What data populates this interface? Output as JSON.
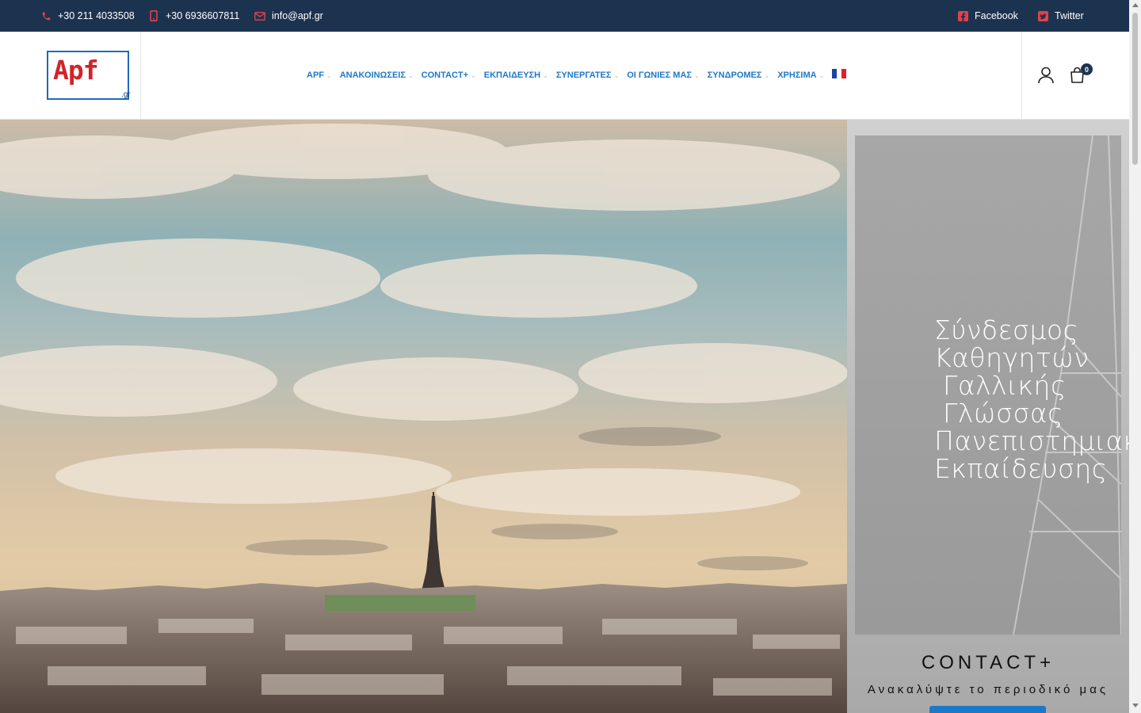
{
  "topbar": {
    "phone": "+30 211 4033508",
    "mobile": "+30 6936607811",
    "email": "info@apf.gr",
    "facebook": "Facebook",
    "twitter": "Twitter",
    "icons": {
      "phone": "phone-icon",
      "mobile": "mobile-icon",
      "email": "envelope-icon",
      "facebook": "facebook-icon",
      "twitter": "twitter-icon"
    },
    "colors": {
      "background": "#1c3350",
      "icon_accent": "#e4404a"
    }
  },
  "logo": {
    "brand": "Apf",
    "tld": ".gr"
  },
  "nav": {
    "items": [
      {
        "label": "APF"
      },
      {
        "label": "ΑΝΑΚΟΙΝΩΣΕΙΣ"
      },
      {
        "label": "CONTACT+"
      },
      {
        "label": "ΕΚΠΑΙΔΕΥΣΗ"
      },
      {
        "label": "ΣΥΝΕΡΓΑΤΕΣ"
      },
      {
        "label": "ΟΙ ΓΩΝΙΕΣ ΜΑΣ"
      },
      {
        "label": "ΣΥΝΔΡΟΜΕΣ"
      },
      {
        "label": "ΧΡΗΣΙΜΑ"
      }
    ],
    "language_flag": "french-flag-icon",
    "color": "#1e78c8"
  },
  "header_actions": {
    "cart_count": "0"
  },
  "side_panel": {
    "title": "Σύνδεσμος\nΚαθηγητών\n Γαλλικής\n Γλώσσας\nΠανεπιστημιακής\nΕκπαίδευσης",
    "contact_title": "CONTACT+",
    "contact_subtitle": "Ανακαλύψτε το περιοδικό μας"
  }
}
